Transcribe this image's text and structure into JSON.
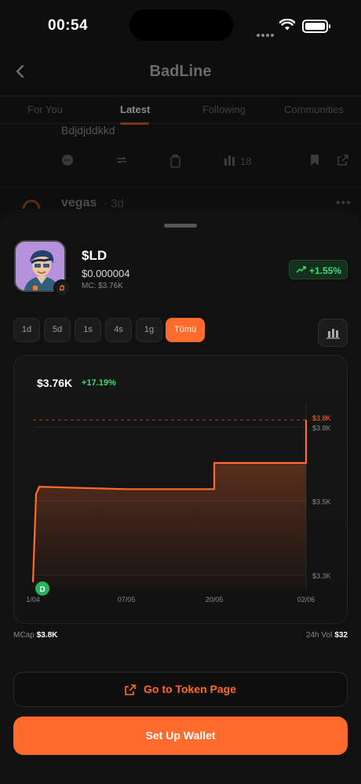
{
  "status_bar": {
    "time": "00:54"
  },
  "header": {
    "title": "BadLine"
  },
  "tabs": [
    {
      "label": "For You"
    },
    {
      "label": "Latest"
    },
    {
      "label": "Following"
    },
    {
      "label": "Communities"
    }
  ],
  "feed": {
    "post_text": "Bdjdjddkkd",
    "views_count": "18",
    "second_post": {
      "author": "vegas",
      "age": "· 3d",
      "more": "•••"
    }
  },
  "token": {
    "symbol": "$LD",
    "price": "$0.000004",
    "market_cap": "MC: $3.76K",
    "change": "+1.55%"
  },
  "timeframes": [
    {
      "label": "1d",
      "active": false
    },
    {
      "label": "5d",
      "active": false
    },
    {
      "label": "1s",
      "active": false
    },
    {
      "label": "4s",
      "active": false
    },
    {
      "label": "1g",
      "active": false
    },
    {
      "label": "Tümü",
      "active": true
    }
  ],
  "chart": {
    "value": "$3.76K",
    "change": "+17.19%",
    "start_marker": "D"
  },
  "chart_data": {
    "type": "area",
    "x_ticks": [
      "1/04",
      "07/05",
      "20/05",
      "02/06"
    ],
    "y_ticks": [
      "$3.8K",
      "$3.5K",
      "$3.3K"
    ],
    "current_label": "$3.8K",
    "points": [
      {
        "x": "1/04",
        "y": 3.23
      },
      {
        "x": "1/04",
        "y": 3.6
      },
      {
        "x": "1/04",
        "y": 3.63
      },
      {
        "x": "07/05",
        "y": 3.62
      },
      {
        "x": "20/05",
        "y": 3.62
      },
      {
        "x": "20/05",
        "y": 3.73
      },
      {
        "x": "02/06",
        "y": 3.73
      },
      {
        "x": "02/06",
        "y": 3.91
      }
    ],
    "ylim": [
      3.2,
      3.95
    ],
    "line_color": "#ff6b2c"
  },
  "stats": {
    "mcap_label": "MCap",
    "mcap_value": "$3.8K",
    "vol_label": "24h Vol",
    "vol_value": "$32"
  },
  "buttons": {
    "goto_label": "Go to Token Page",
    "wallet_label": "Set Up Wallet"
  },
  "colors": {
    "accent": "#ff6b2c",
    "positive": "#3ddc74",
    "background": "#111111"
  }
}
